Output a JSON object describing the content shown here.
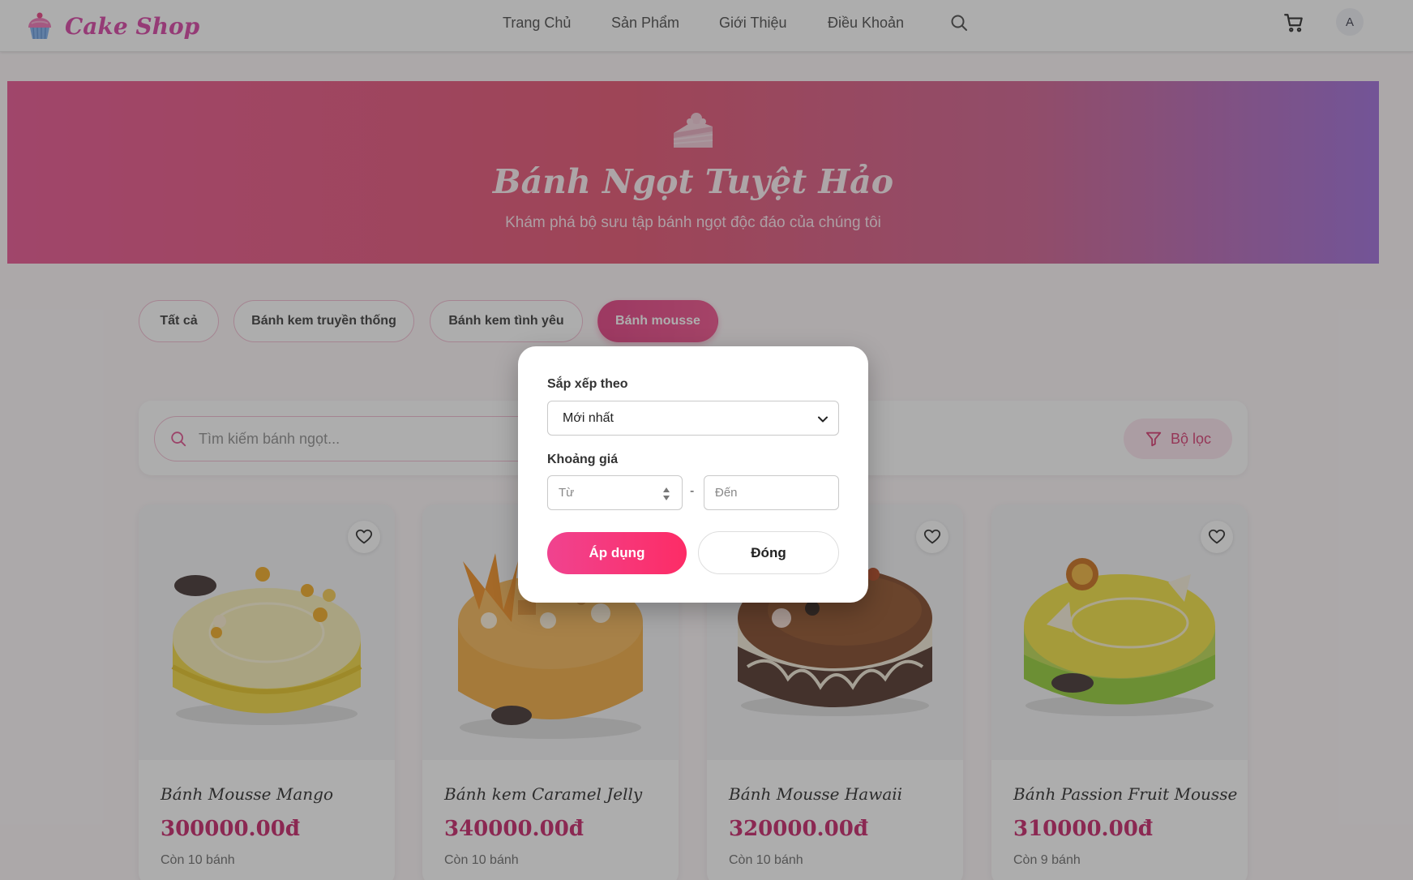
{
  "navbar": {
    "brand": "Cake Shop",
    "links": [
      "Trang Chủ",
      "Sản Phẩm",
      "Giới Thiệu",
      "Điều Khoản"
    ],
    "avatar_initial": "A"
  },
  "hero": {
    "title": "Bánh Ngọt Tuyệt Hảo",
    "subtitle": "Khám phá bộ sưu tập bánh ngọt độc đáo của chúng tôi"
  },
  "categories": [
    {
      "label": "Tất cả",
      "active": false
    },
    {
      "label": "Bánh kem truyền thống",
      "active": false
    },
    {
      "label": "Bánh kem tình yêu",
      "active": false
    },
    {
      "label": "Bánh mousse",
      "active": true
    }
  ],
  "search": {
    "placeholder": "Tìm kiếm bánh ngọt...",
    "filter_label": "Bộ lọc"
  },
  "products": [
    {
      "name": "Bánh Mousse Mango",
      "price": "300000.00đ",
      "stock": "Còn 10 bánh"
    },
    {
      "name": "Bánh kem Caramel Jelly",
      "price": "340000.00đ",
      "stock": "Còn 10 bánh"
    },
    {
      "name": "Bánh Mousse Hawaii",
      "price": "320000.00đ",
      "stock": "Còn 10 bánh"
    },
    {
      "name": "Bánh Passion Fruit Mousse",
      "price": "310000.00đ",
      "stock": "Còn 9 bánh"
    }
  ],
  "filter_modal": {
    "sort_label": "Sắp xếp theo",
    "sort_value": "Mới nhất",
    "price_label": "Khoảng giá",
    "from_placeholder": "Từ",
    "dash": "-",
    "to_placeholder": "Đến",
    "apply_label": "Áp dụng",
    "close_label": "Đóng"
  },
  "colors": {
    "brand": "#d63ca0",
    "accent": "#e3387e",
    "price": "#c41a62"
  }
}
